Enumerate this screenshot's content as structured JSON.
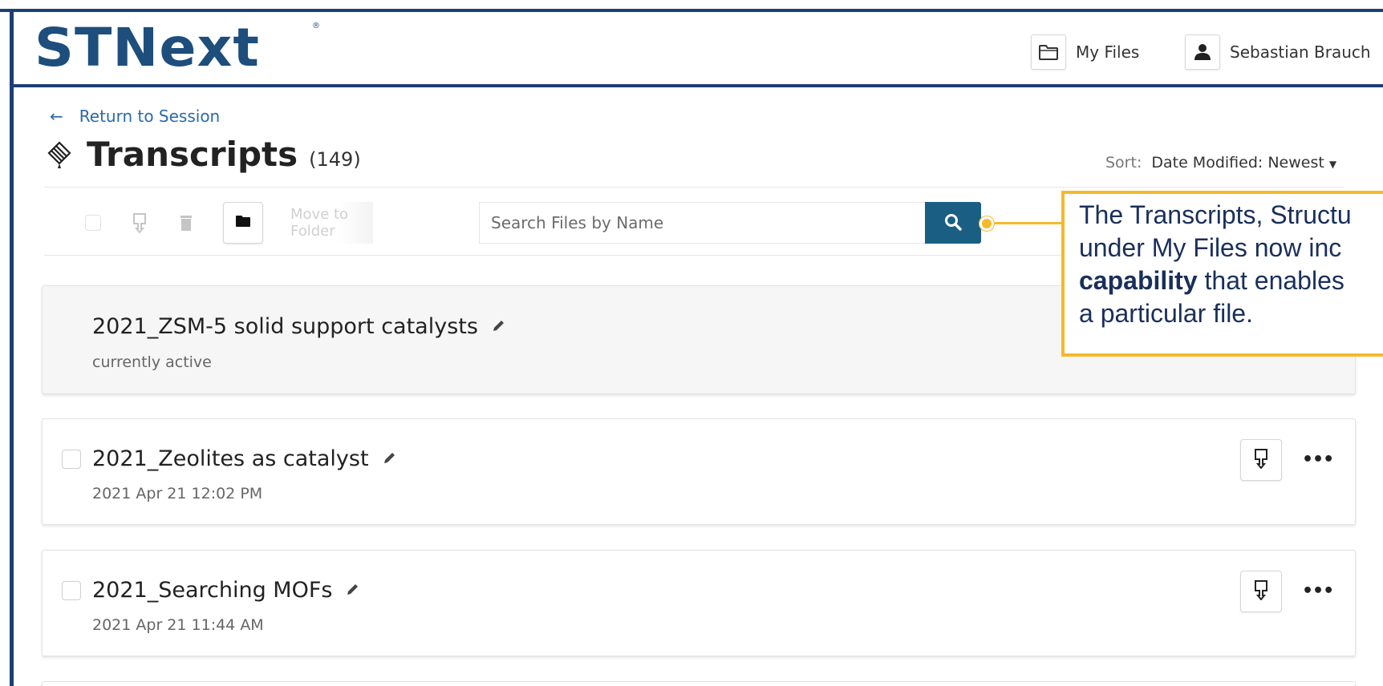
{
  "header": {
    "logo": "STNext",
    "logo_mark": "®",
    "my_files_label": "My Files",
    "user_name": "Sebastian Brauch"
  },
  "nav": {
    "return_label": "Return to Session"
  },
  "page": {
    "title": "Transcripts",
    "count": "(149)"
  },
  "sort": {
    "label": "Sort:",
    "value": "Date Modified: Newest"
  },
  "toolbar": {
    "move_label": "Move to Folder",
    "search_placeholder": "Search Files by Name"
  },
  "callout": {
    "line1": "The Transcripts, Structu",
    "line2": "under My Files now inc",
    "line3_bold": "capability",
    "line3_rest": " that enables",
    "line4": "a particular file."
  },
  "files": [
    {
      "name": "2021_ZSM-5 solid support catalysts",
      "subtitle": "currently active"
    },
    {
      "name": "2021_Zeolites as catalyst",
      "subtitle": "2021 Apr 21 12:02 PM"
    },
    {
      "name": "2021_Searching MOFs",
      "subtitle": "2021 Apr 21 11:44 AM"
    }
  ],
  "colors": {
    "brand": "#1d4e7c",
    "frame": "#1d3f75",
    "link": "#2a6aa8",
    "search_button": "#1b5e84",
    "callout_border": "#f5b92b"
  },
  "icons": {
    "title": "transcripts-icon",
    "folder": "folder-icon",
    "user": "user-icon",
    "search": "search-icon",
    "download": "download-icon",
    "edit": "pencil-icon",
    "more": "more-icon"
  }
}
